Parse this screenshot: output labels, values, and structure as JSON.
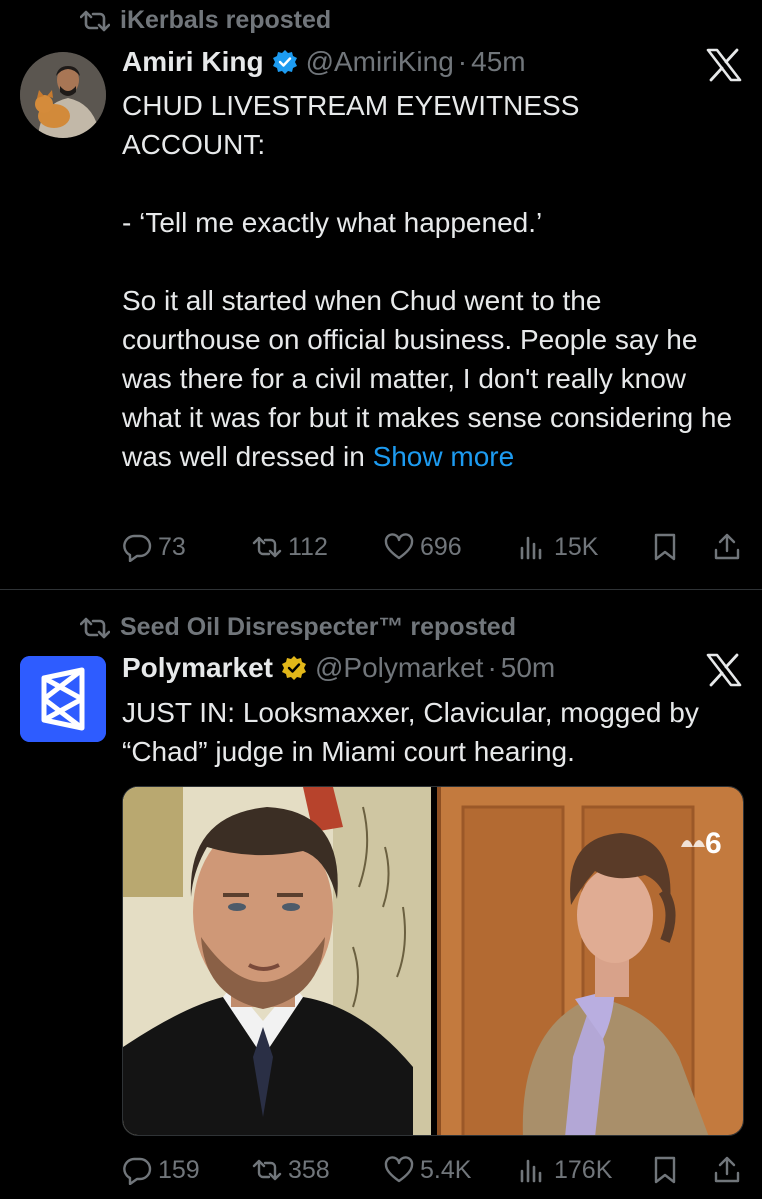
{
  "post1": {
    "repost_label": "iKerbals reposted",
    "author_name": "Amiri King",
    "handle": "@AmiriKing",
    "separator": "·",
    "time": "45m",
    "text_line1": "CHUD LIVESTREAM EYEWITNESS",
    "text_line2": "ACCOUNT:",
    "text_quote": "- ‘Tell me exactly what happened.’",
    "text_body": "So it all started when Chud went to the courthouse on official business. People say he was there for a civil matter, I don't really know what it was for but it makes sense considering he was well dressed in ",
    "show_more": "Show more",
    "replies": "73",
    "reposts": "112",
    "likes": "696",
    "views": "15K"
  },
  "post2": {
    "repost_label": "Seed Oil Disrespecter™ reposted",
    "author_name": "Polymarket",
    "handle": "@Polymarket",
    "separator": "·",
    "time": "50m",
    "text_line1": "JUST IN: Looksmaxxer, Clavicular, mogged by",
    "text_line2": "“Chad” judge in Miami court hearing.",
    "media_watermark": "6",
    "replies": "159",
    "reposts": "358",
    "likes": "5.4K",
    "views": "176K"
  },
  "colors": {
    "background": "#000000",
    "text": "#e7e9ea",
    "muted": "#71767b",
    "link": "#1d9bf0",
    "verified_blue": "#1d9bf0",
    "verified_gold": "#e2b719",
    "polymarket_blue": "#2e5cff"
  },
  "icons": [
    "repost-icon",
    "verified-badge-icon",
    "x-logo-icon",
    "reply-icon",
    "like-icon",
    "views-icon",
    "bookmark-icon",
    "share-icon"
  ]
}
